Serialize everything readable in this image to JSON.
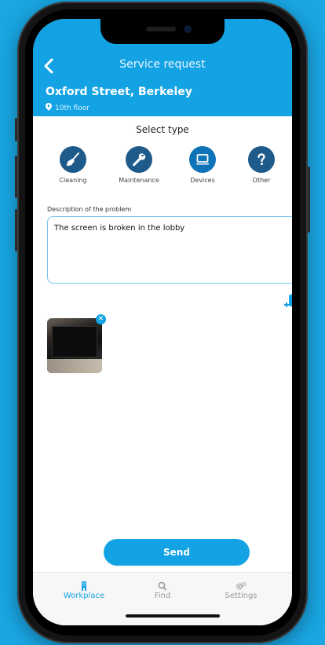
{
  "header": {
    "title": "Service request",
    "location": "Oxford Street, Berkeley",
    "floor": "10th floor"
  },
  "select_type": {
    "label": "Select type",
    "items": [
      {
        "label": "Cleaning",
        "icon": "broom-icon"
      },
      {
        "label": "Maintenance",
        "icon": "wrench-icon"
      },
      {
        "label": "Devices",
        "icon": "laptop-icon",
        "selected": true
      },
      {
        "label": "Other",
        "icon": "question-icon"
      }
    ]
  },
  "description": {
    "label": "Description of the problem",
    "value": "The screen is broken in the lobby"
  },
  "send_label": "Send",
  "nav": {
    "items": [
      {
        "label": "Workplace",
        "icon": "building-icon",
        "active": true
      },
      {
        "label": "Find",
        "icon": "search-icon"
      },
      {
        "label": "Settings",
        "icon": "gears-icon"
      }
    ]
  },
  "colors": {
    "accent": "#13a3e4",
    "icon_bg": "#1e5a8a",
    "background": "#19a6e3"
  }
}
